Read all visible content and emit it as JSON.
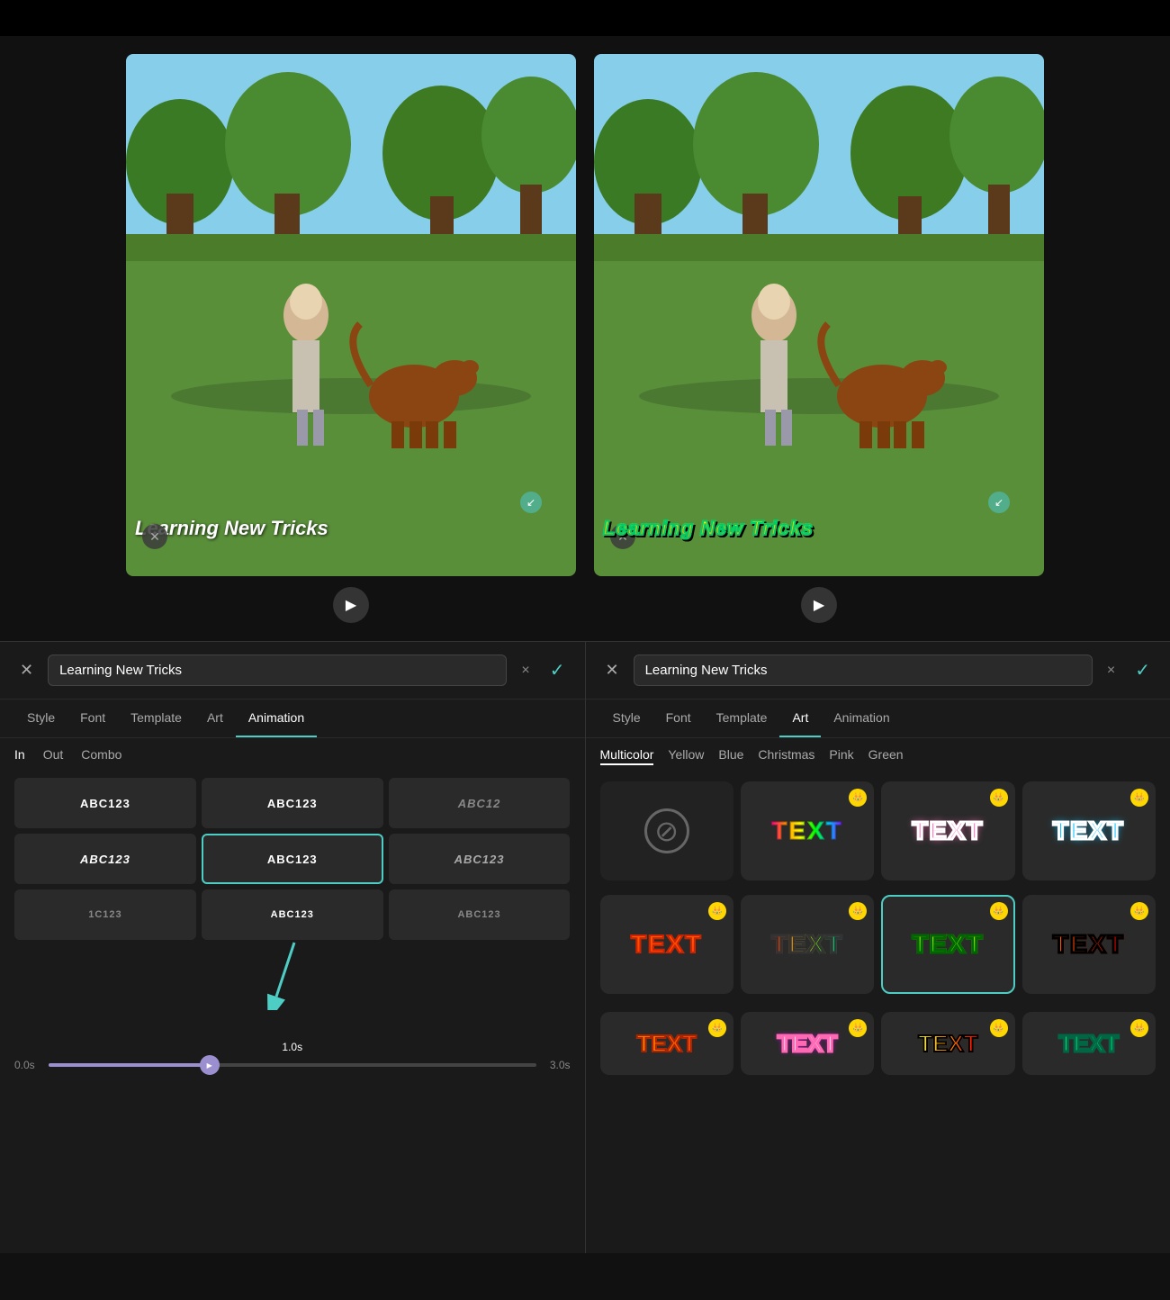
{
  "topBar": {
    "height": 40
  },
  "videos": [
    {
      "id": "left",
      "caption": "Learning New Tricks",
      "captionStyle": "plain",
      "playLabel": "▶"
    },
    {
      "id": "right",
      "caption": "Learning New Tricks",
      "captionStyle": "art",
      "playLabel": "▶"
    }
  ],
  "panelLeft": {
    "closeLabel": "✕",
    "inputValue": "Learning New Tricks",
    "inputPlaceholder": "Learning New Tricks",
    "clearLabel": "×",
    "confirmLabel": "✓",
    "tabs": [
      {
        "label": "Style",
        "active": false
      },
      {
        "label": "Font",
        "active": false
      },
      {
        "label": "Template",
        "active": false
      },
      {
        "label": "Art",
        "active": false
      },
      {
        "label": "Animation",
        "active": true
      }
    ],
    "subtabs": [
      {
        "label": "In",
        "active": true
      },
      {
        "label": "Out",
        "active": false
      },
      {
        "label": "Combo",
        "active": false
      }
    ],
    "animCells": [
      {
        "label": "ABC123",
        "style": "normal",
        "selected": false
      },
      {
        "label": "ABC123",
        "style": "normal",
        "selected": false
      },
      {
        "label": "ABC12",
        "style": "fade",
        "selected": false
      },
      {
        "label": "ABC123",
        "style": "bold-italic",
        "selected": false
      },
      {
        "label": "ABC123",
        "style": "outline",
        "selected": true
      },
      {
        "label": "ABC123",
        "style": "italic",
        "selected": false
      },
      {
        "label": "1C123",
        "style": "partial-left",
        "selected": false
      },
      {
        "label": "ABC123",
        "style": "small",
        "selected": false
      },
      {
        "label": "ABC123",
        "style": "small-partial",
        "selected": false
      }
    ],
    "timeline": {
      "startLabel": "0.0s",
      "endLabel": "3.0s",
      "currentLabel": "1.0s",
      "fillPercent": 33
    },
    "arrowNote": "points to timeline thumb"
  },
  "panelRight": {
    "closeLabel": "✕",
    "inputValue": "Learning New Tricks",
    "inputPlaceholder": "Learning New Tricks",
    "clearLabel": "×",
    "confirmLabel": "✓",
    "tabs": [
      {
        "label": "Style",
        "active": false
      },
      {
        "label": "Font",
        "active": false
      },
      {
        "label": "Template",
        "active": false
      },
      {
        "label": "Art",
        "active": true
      },
      {
        "label": "Animation",
        "active": false
      }
    ],
    "artFilters": [
      {
        "label": "Multicolor",
        "active": true
      },
      {
        "label": "Yellow",
        "active": false
      },
      {
        "label": "Blue",
        "active": false
      },
      {
        "label": "Christmas",
        "active": false
      },
      {
        "label": "Pink",
        "active": false
      },
      {
        "label": "Green",
        "active": false
      }
    ],
    "artCells": [
      {
        "id": "none",
        "type": "disabled",
        "hasCrown": false
      },
      {
        "id": "rainbow",
        "type": "rainbow",
        "hasCrown": true,
        "label": "TEXT"
      },
      {
        "id": "pink-outline",
        "type": "pink-outline",
        "hasCrown": true,
        "label": "TEXT"
      },
      {
        "id": "blue-outline",
        "type": "blue-outline",
        "hasCrown": true,
        "label": "TEXT"
      },
      {
        "id": "orange",
        "type": "orange",
        "hasCrown": true,
        "label": "TEXT"
      },
      {
        "id": "multicolor-outline",
        "type": "multicolor-outline",
        "hasCrown": true,
        "label": "TEXT"
      },
      {
        "id": "green-yellow",
        "type": "green-yellow",
        "selected": true,
        "hasCrown": true,
        "label": "TEXT"
      },
      {
        "id": "dark-outline",
        "type": "dark-outline",
        "hasCrown": true,
        "label": "TEXT"
      }
    ],
    "artBottomCells": [
      {
        "id": "b1",
        "hasCrown": true
      },
      {
        "id": "b2",
        "hasCrown": true
      },
      {
        "id": "b3",
        "hasCrown": true
      },
      {
        "id": "b4",
        "hasCrown": true
      }
    ]
  }
}
